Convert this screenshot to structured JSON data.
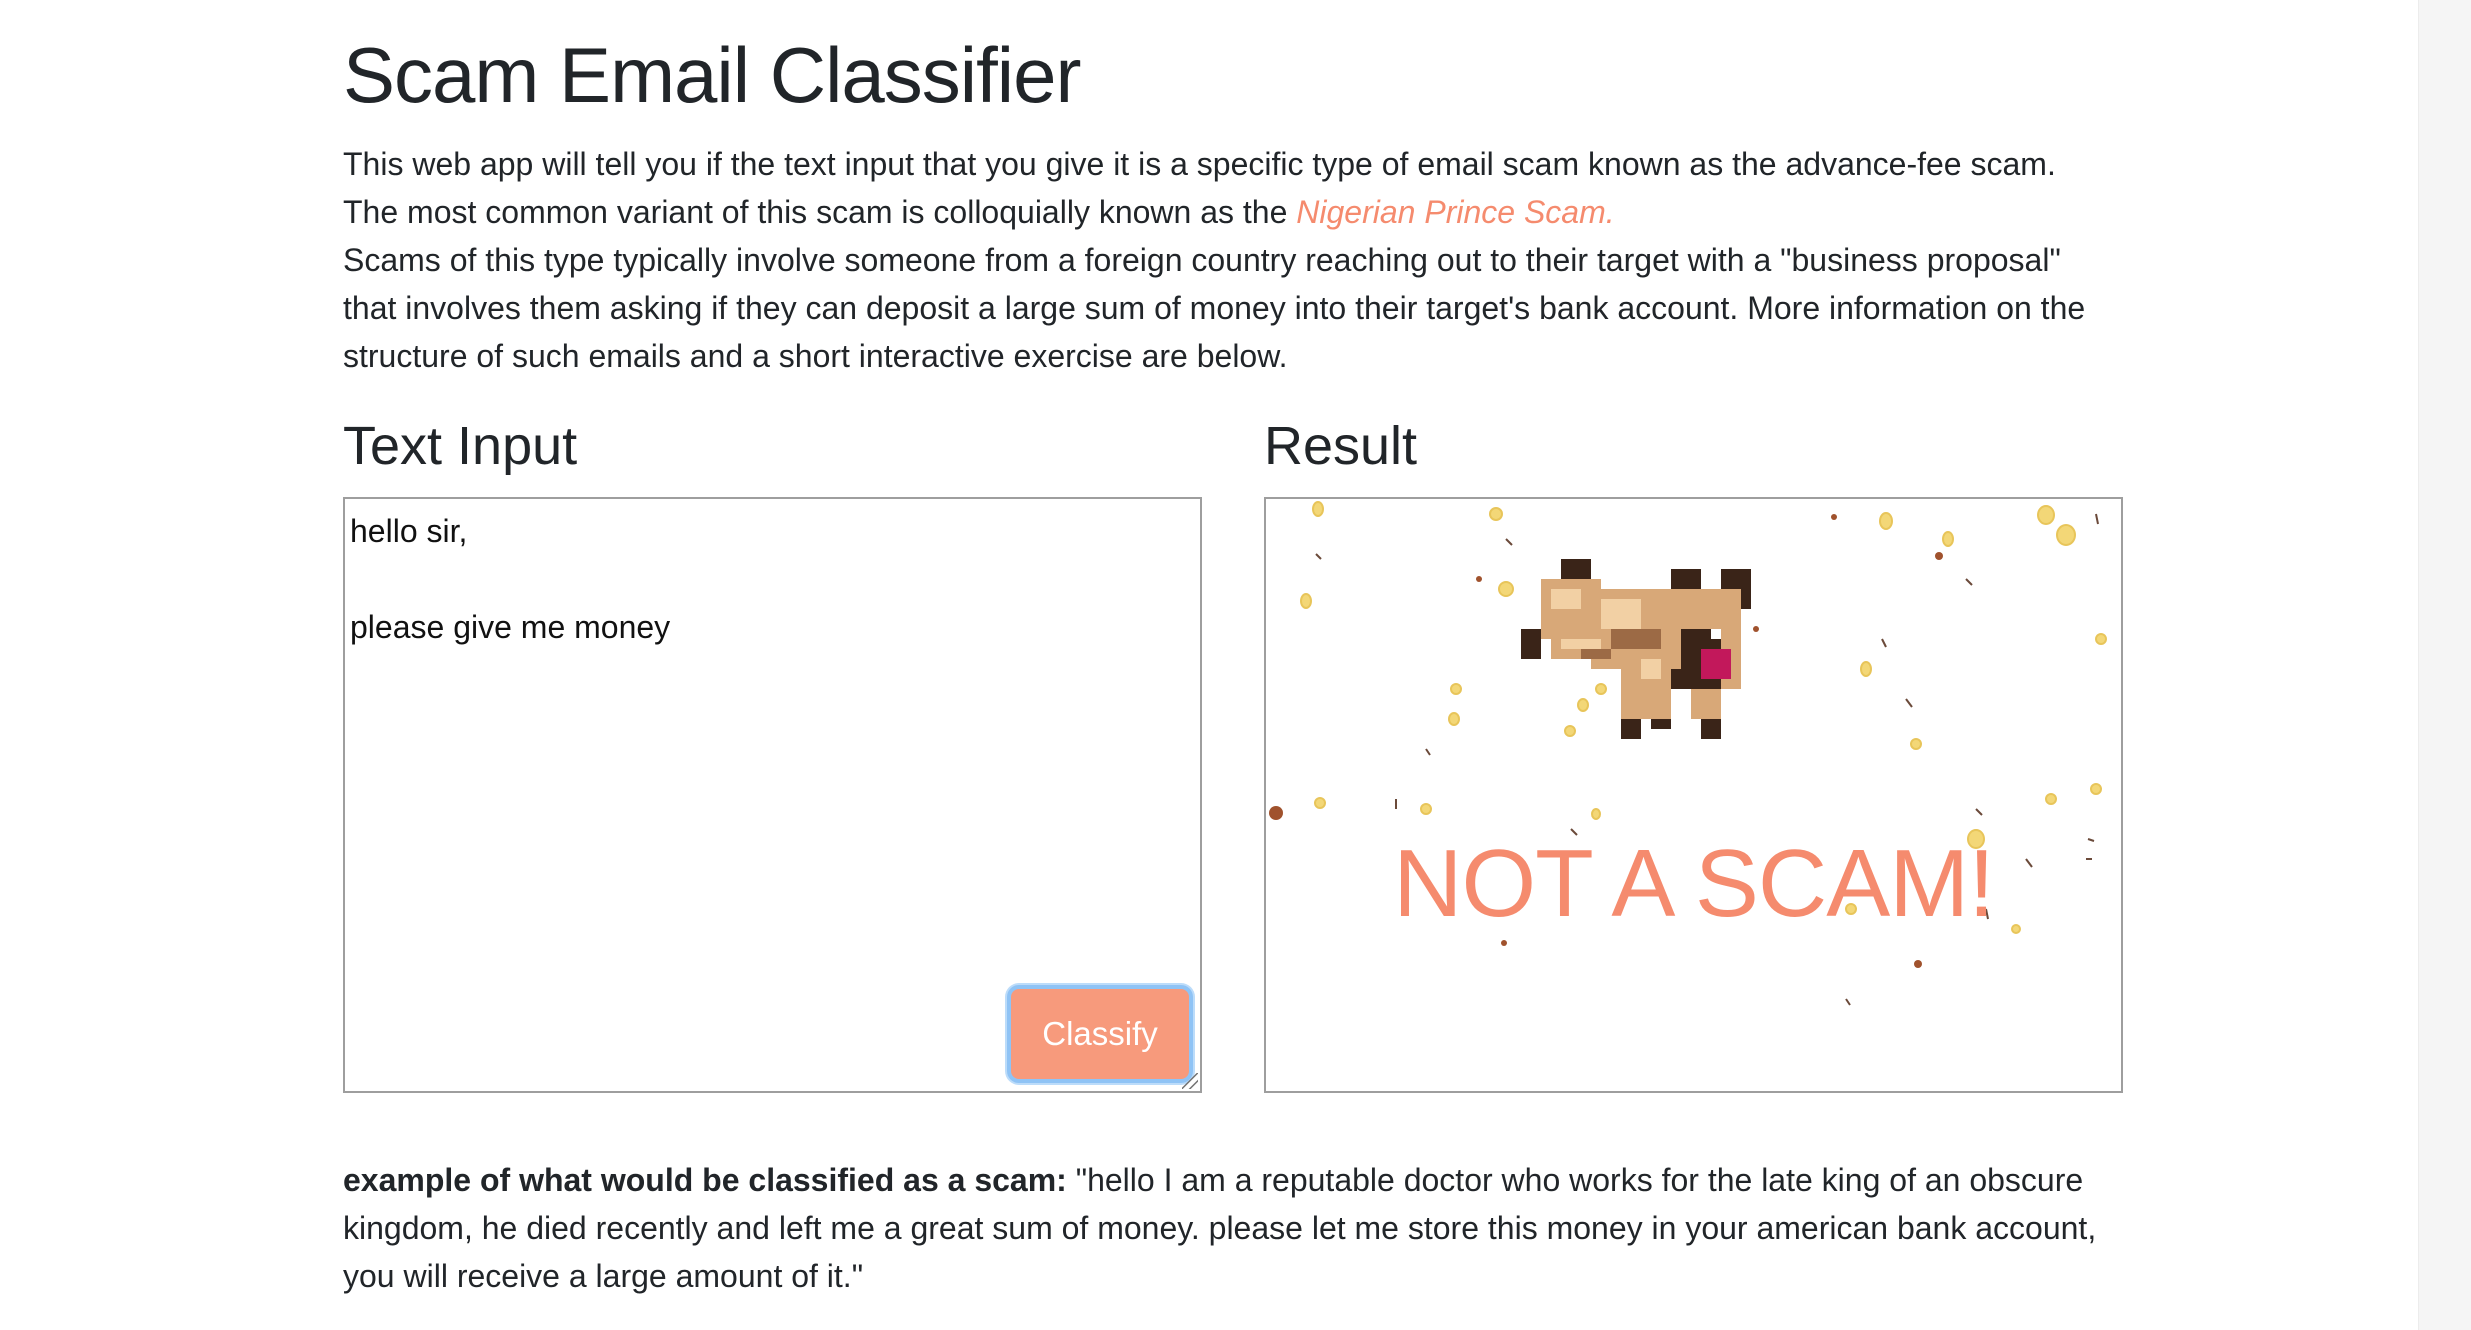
{
  "page": {
    "title": "Scam Email Classifier",
    "intro_line1": "This web app will tell you if the text input that you give it is a specific type of email scam known as the advance-fee scam.",
    "intro_line2_prefix": "The most common variant of this scam is colloquially known as the ",
    "intro_link": "Nigerian Prince Scam.",
    "intro_para2": "Scams of this type typically involve someone from a foreign country reaching out to their target with a \"business proposal\" that involves them asking if they can deposit a large sum of money into their target's bank account. More information on the structure of such emails and a short interactive exercise are below."
  },
  "input_section": {
    "heading": "Text Input",
    "textarea_value": "hello sir,\n\nplease give me money",
    "button_label": "Classify"
  },
  "result_section": {
    "heading": "Result",
    "result_text": "NOT A SCAM!",
    "image": "pixel-pug-with-confetti"
  },
  "example": {
    "label": "example of what would be classified as a scam:",
    "text": " \"hello I am a reputable doctor who works for the late king of an obscure kingdom, he died recently and left me a great sum of money. please let me store this money in your american bank account, you will receive a large amount of it.\""
  },
  "colors": {
    "accent": "#f58b6e",
    "button": "#f79a7c",
    "focus_ring": "#8fc3f5"
  }
}
